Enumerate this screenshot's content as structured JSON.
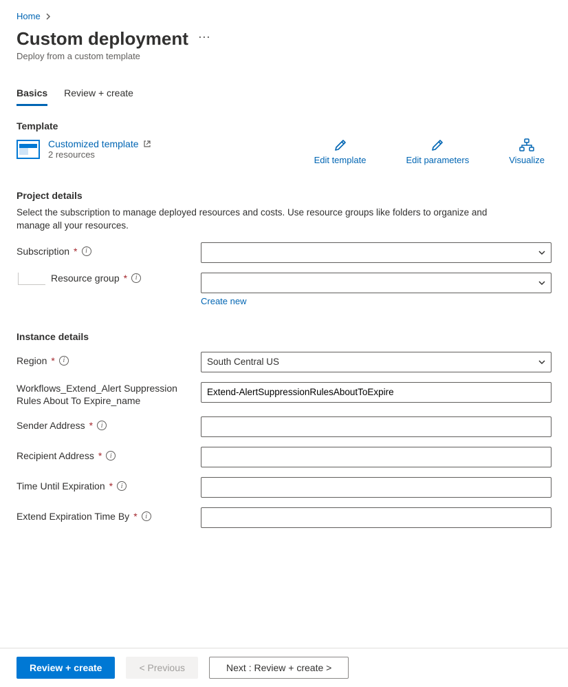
{
  "breadcrumb": {
    "home": "Home"
  },
  "header": {
    "title": "Custom deployment",
    "subtitle": "Deploy from a custom template"
  },
  "tabs": {
    "basics": "Basics",
    "review": "Review + create"
  },
  "template_section": {
    "heading": "Template",
    "link_label": "Customized template",
    "resources": "2 resources",
    "edit_template": "Edit template",
    "edit_parameters": "Edit parameters",
    "visualize": "Visualize"
  },
  "project": {
    "heading": "Project details",
    "description": "Select the subscription to manage deployed resources and costs. Use resource groups like folders to organize and manage all your resources.",
    "subscription_label": "Subscription",
    "subscription_value": "",
    "resource_group_label": "Resource group",
    "resource_group_value": "",
    "create_new": "Create new"
  },
  "instance": {
    "heading": "Instance details",
    "region_label": "Region",
    "region_value": "South Central US",
    "workflow_label": "Workflows_Extend_Alert Suppression Rules About To Expire_name",
    "workflow_value": "Extend-AlertSuppressionRulesAboutToExpire",
    "sender_label": "Sender Address",
    "sender_value": "",
    "recipient_label": "Recipient Address",
    "recipient_value": "",
    "time_until_label": "Time Until Expiration",
    "time_until_value": "",
    "extend_by_label": "Extend Expiration Time By",
    "extend_by_value": ""
  },
  "footer": {
    "review": "Review + create",
    "previous": "< Previous",
    "next": "Next : Review + create >"
  }
}
